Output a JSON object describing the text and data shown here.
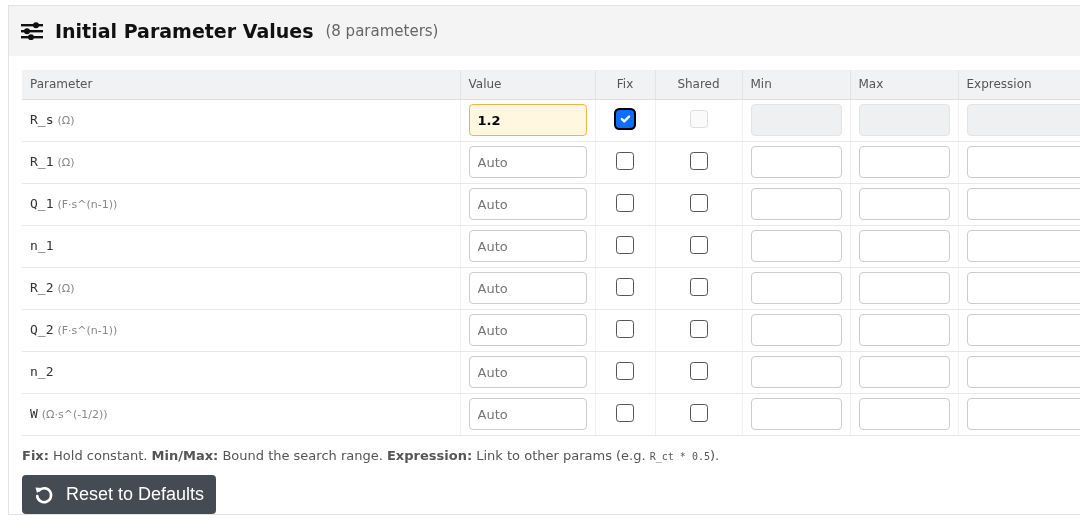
{
  "panel": {
    "title": "Initial Parameter Values",
    "count": "(8 parameters)"
  },
  "table": {
    "columns": [
      "Parameter",
      "Value",
      "Fix",
      "Shared",
      "Min",
      "Max",
      "Expression"
    ],
    "rows": [
      {
        "name": "R_s",
        "unit": "(Ω)",
        "value": "1.2",
        "edited": true,
        "fix_checked": true,
        "shared_checked": false,
        "shared_disabled": true,
        "bounds_disabled": true
      },
      {
        "name": "R_1",
        "unit": "(Ω)",
        "placeholder": "Auto",
        "edited": false,
        "fix_checked": false,
        "shared_checked": false,
        "shared_disabled": false,
        "bounds_disabled": false
      },
      {
        "name": "Q_1",
        "unit": "(F·s^(n-1))",
        "placeholder": "Auto",
        "edited": false,
        "fix_checked": false,
        "shared_checked": false,
        "shared_disabled": false,
        "bounds_disabled": false
      },
      {
        "name": "n_1",
        "placeholder": "Auto",
        "edited": false,
        "fix_checked": false,
        "shared_checked": false,
        "shared_disabled": false,
        "bounds_disabled": false
      },
      {
        "name": "R_2",
        "unit": "(Ω)",
        "placeholder": "Auto",
        "edited": false,
        "fix_checked": false,
        "shared_checked": false,
        "shared_disabled": false,
        "bounds_disabled": false
      },
      {
        "name": "Q_2",
        "unit": "(F·s^(n-1))",
        "placeholder": "Auto",
        "edited": false,
        "fix_checked": false,
        "shared_checked": false,
        "shared_disabled": false,
        "bounds_disabled": false
      },
      {
        "name": "n_2",
        "placeholder": "Auto",
        "edited": false,
        "fix_checked": false,
        "shared_checked": false,
        "shared_disabled": false,
        "bounds_disabled": false
      },
      {
        "name": "W",
        "unit": "(Ω·s^(-1/2))",
        "placeholder": "Auto",
        "edited": false,
        "fix_checked": false,
        "shared_checked": false,
        "shared_disabled": false,
        "bounds_disabled": false
      }
    ]
  },
  "note": [
    {
      "kind": "bold",
      "text": "Fix:"
    },
    {
      "kind": "text",
      "text": " Hold constant. "
    },
    {
      "kind": "bold",
      "text": "Min/Max:"
    },
    {
      "kind": "text",
      "text": " Bound the search range. "
    },
    {
      "kind": "bold",
      "text": "Expression:"
    },
    {
      "kind": "text",
      "text": " Link to other params (e.g. "
    },
    {
      "kind": "code",
      "text": "R_ct * 0.5"
    },
    {
      "kind": "text",
      "text": ")."
    }
  ],
  "reset_button": {
    "label": "Reset to Defaults"
  }
}
